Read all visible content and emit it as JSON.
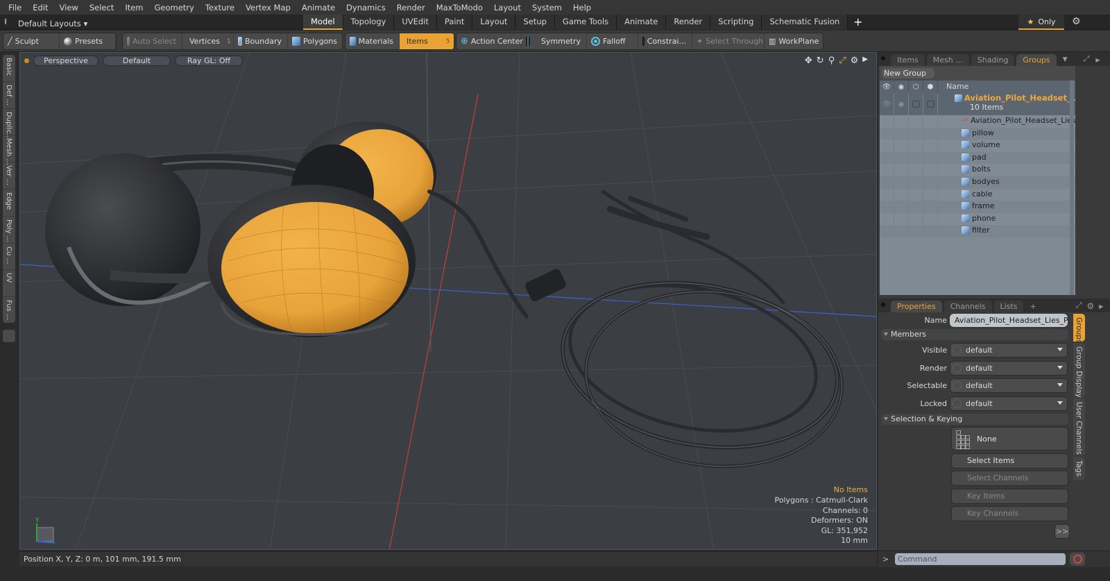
{
  "menu": [
    "File",
    "Edit",
    "View",
    "Select",
    "Item",
    "Geometry",
    "Texture",
    "Vertex Map",
    "Animate",
    "Dynamics",
    "Render",
    "MaxToModo",
    "Layout",
    "System",
    "Help"
  ],
  "layout_bar": {
    "layouts_label": "Default Layouts",
    "tabs": [
      "Model",
      "Topology",
      "UVEdit",
      "Paint",
      "Layout",
      "Setup",
      "Game Tools",
      "Animate",
      "Render",
      "Scripting",
      "Schematic Fusion"
    ],
    "active_tab": "Model",
    "add_tab": "+",
    "only_label": "Only"
  },
  "toolbar": {
    "sculpt": "Sculpt",
    "presets": "Presets",
    "auto_select": "Auto Select",
    "vertices": "Vertices",
    "vertices_count": "1",
    "boundary": "Boundary",
    "polygons": "Polygons",
    "materials": "Materials",
    "items": "Items",
    "items_count": "5",
    "action_center": "Action Center",
    "symmetry": "Symmetry",
    "falloff": "Falloff",
    "constraints": "Constrai...",
    "select_through": "Select Through",
    "workplane": "WorkPlane"
  },
  "left_tabs": [
    "Basic",
    "Def ...",
    "Duplic...",
    "Mesh ...",
    "Ver ...",
    "Edge",
    "Poly ...",
    "Cu ...",
    "UV",
    "Fus ..."
  ],
  "viewport": {
    "view_mode": "Perspective",
    "shading": "Default",
    "raygl": "Ray GL: Off",
    "info": {
      "selection": "No Items",
      "polygons": "Polygons : Catmull-Clark",
      "channels": "Channels: 0",
      "deformers": "Deformers: ON",
      "gl": "GL: 351,952",
      "grid": "10 mm"
    },
    "axis_label": "Y",
    "colors": {
      "earcup": "#e8a33a",
      "background": "#3b3f44"
    }
  },
  "status": {
    "position": "Position X, Y, Z:   0 m, 101 mm, 191.5 mm"
  },
  "groups_panel": {
    "tabs": [
      "Items",
      "Mesh ...",
      "Shading",
      "Groups"
    ],
    "active_tab": "Groups",
    "new_group": "New Group",
    "column_name": "Name",
    "group": {
      "name": "Aviation_Pilot_Headset_L...",
      "count": "10 Items"
    },
    "children": [
      {
        "name": "Aviation_Pilot_Headset_Lies...",
        "type": "locator"
      },
      {
        "name": "pillow",
        "type": "mesh"
      },
      {
        "name": "volume",
        "type": "mesh"
      },
      {
        "name": "pad",
        "type": "mesh"
      },
      {
        "name": "bolts",
        "type": "mesh"
      },
      {
        "name": "bodyes",
        "type": "mesh"
      },
      {
        "name": "cable",
        "type": "mesh"
      },
      {
        "name": "frame",
        "type": "mesh"
      },
      {
        "name": "phone",
        "type": "mesh"
      },
      {
        "name": "filter",
        "type": "mesh"
      }
    ]
  },
  "properties_panel": {
    "tabs": [
      "Properties",
      "Channels",
      "Lists"
    ],
    "active_tab": "Properties",
    "add_tab": "+",
    "name_label": "Name",
    "name_value": "Aviation_Pilot_Headset_Lies_Pos",
    "members_section": "Members",
    "members": [
      {
        "label": "Visible",
        "value": "default"
      },
      {
        "label": "Render",
        "value": "default"
      },
      {
        "label": "Selectable",
        "value": "default"
      },
      {
        "label": "Locked",
        "value": "default"
      }
    ],
    "keying_section": "Selection & Keying",
    "none_label": "None",
    "select_items": "Select Items",
    "select_channels": "Select Channels",
    "key_items": "Key Items",
    "key_channels": "Key Channels",
    "more": ">>",
    "side_tabs": [
      "Groups",
      "Group Display",
      "User Channels",
      "Tags"
    ]
  },
  "command": {
    "prompt": ">",
    "placeholder": "Command"
  }
}
